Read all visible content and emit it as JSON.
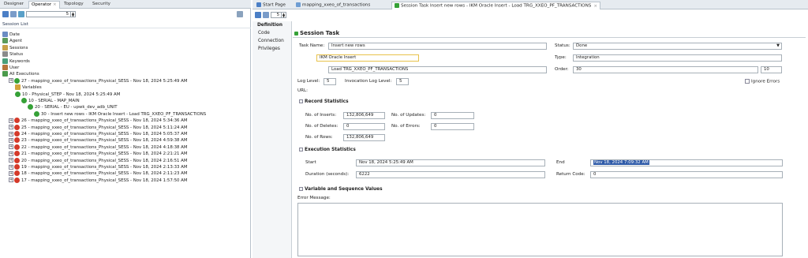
{
  "left": {
    "tabs": [
      "Designer",
      "Operator",
      "Topology",
      "Security"
    ],
    "toolbar_spinner": "5",
    "section_title": "Session List",
    "tree": [
      {
        "label": "Date",
        "indent": 0
      },
      {
        "label": "Agent",
        "indent": 0
      },
      {
        "label": "Sessions",
        "indent": 0
      },
      {
        "label": "Status",
        "indent": 0
      },
      {
        "label": "Keywords",
        "indent": 0
      },
      {
        "label": "User",
        "indent": 0
      },
      {
        "label": "All Executions",
        "indent": 0
      },
      {
        "label": "27 - mapping_xxeo_of_transactions_Physical_SESS - Nov 18, 2024 5:25:49 AM",
        "indent": 1,
        "status": "ok"
      },
      {
        "label": "Variables",
        "indent": 2
      },
      {
        "label": "10 - Physical_STEP - Nov 18, 2024 5:25:49 AM",
        "indent": 2,
        "status": "ok"
      },
      {
        "label": "10 - SERIAL - MAP_MAIN",
        "indent": 3,
        "status": "ok"
      },
      {
        "label": "20 - SERIAL - EU - upwk_dev_adb_UNIT",
        "indent": 4,
        "status": "ok"
      },
      {
        "label": "30 - Insert new rows - IKM Oracle Insert - Load TRG_XXEO_PF_TRANSACTIONS",
        "indent": 5,
        "status": "ok"
      },
      {
        "label": "26 - mapping_xxeo_of_transactions_Physical_SESS - Nov 18, 2024 5:34:36 AM",
        "indent": 1,
        "status": "err"
      },
      {
        "label": "25 - mapping_xxeo_of_transactions_Physical_SESS - Nov 18, 2024 5:11:24 AM",
        "indent": 1,
        "status": "err"
      },
      {
        "label": "24 - mapping_xxeo_of_transactions_Physical_SESS - Nov 18, 2024 5:05:37 AM",
        "indent": 1,
        "status": "err"
      },
      {
        "label": "23 - mapping_xxeo_of_transactions_Physical_SESS - Nov 18, 2024 4:59:38 AM",
        "indent": 1,
        "status": "err"
      },
      {
        "label": "22 - mapping_xxeo_of_transactions_Physical_SESS - Nov 18, 2024 4:18:38 AM",
        "indent": 1,
        "status": "err"
      },
      {
        "label": "21 - mapping_xxeo_of_transactions_Physical_SESS - Nov 18, 2024 2:21:21 AM",
        "indent": 1,
        "status": "err"
      },
      {
        "label": "20 - mapping_xxeo_of_transactions_Physical_SESS - Nov 18, 2024 2:16:51 AM",
        "indent": 1,
        "status": "err"
      },
      {
        "label": "19 - mapping_xxeo_of_transactions_Physical_SESS - Nov 18, 2024 2:13:33 AM",
        "indent": 1,
        "status": "err"
      },
      {
        "label": "18 - mapping_xxeo_of_transactions_Physical_SESS - Nov 18, 2024 2:11:23 AM",
        "indent": 1,
        "status": "err"
      },
      {
        "label": "17 - mapping_xxeo_of_transactions_Physical_SESS - Nov 18, 2024 1:57:50 AM",
        "indent": 1,
        "status": "err"
      }
    ]
  },
  "right": {
    "tabs": [
      "Start Page",
      "mapping_xxeo_of_transactions",
      "Session Task Insert new rows - IKM Oracle Insert - Load TRG_XXEO_PF_TRANSACTIONS"
    ],
    "toolbar_spinner": "5",
    "nav": [
      "Definition",
      "Code",
      "Connection",
      "Privileges"
    ],
    "title": "Session Task",
    "task_name_label": "Task Name:",
    "task_name": "Insert new rows",
    "km": "IKM Oracle Insert",
    "target": "Load TRG_XXEO_PF_TRANSACTIONS",
    "status_label": "Status:",
    "status": "Done",
    "type_label": "Type:",
    "type": "Integration",
    "order_label": "Order:",
    "order": "30",
    "order2": "10",
    "log_level_label": "Log Level:",
    "log_level": "5",
    "inv_log_label": "Invocation Log Level:",
    "inv_log": "5",
    "ignore_errors": "Ignore Errors",
    "url_label": "URL:",
    "record_stats": "Record Statistics",
    "inserts_label": "No. of Inserts:",
    "inserts": "132,806,649",
    "updates_label": "No. of Updates:",
    "updates": "0",
    "deletes_label": "No. of Deletes:",
    "deletes": "0",
    "errors_label": "No. of Errors:",
    "errors": "0",
    "rows_label": "No. of Rows:",
    "rows": "132,806,649",
    "exec_stats": "Execution Statistics",
    "start_label": "Start",
    "start": "Nov 18, 2024 5:25:49 AM",
    "end_label": "End",
    "end": "Nov 18, 2024 7:09:32 AM",
    "duration_label": "Duration (seconds):",
    "duration": "6222",
    "return_code_label": "Return Code:",
    "return_code": "0",
    "var_seq": "Variable and Sequence Values",
    "error_msg_label": "Error Message:"
  },
  "colors": {
    "accent": "#2e5aa8",
    "ok": "#36a137",
    "error": "#d43a2a",
    "selection": "#2e5aa8"
  }
}
